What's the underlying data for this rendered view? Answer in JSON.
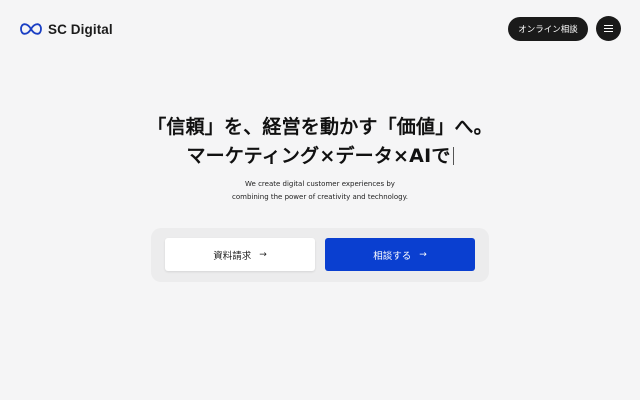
{
  "header": {
    "logo_text": "SC Digital",
    "logo_icon": "infinity-icon",
    "consult_button": "オンライン相談",
    "menu_icon": "hamburger-menu-icon"
  },
  "hero": {
    "headline_line1": "「信頼」を、経営を動かす「価値」へ。",
    "headline_line2": "マーケティング×データ×AIで",
    "subtext_line1": "We create digital customer experiences by",
    "subtext_line2": "combining the power of creativity and technology."
  },
  "cta": {
    "document_request": "資料請求",
    "consult": "相談する",
    "arrow": "→"
  },
  "colors": {
    "background": "#f5f5f6",
    "primary_blue": "#0a3fd0",
    "dark": "#1a1a1a"
  }
}
